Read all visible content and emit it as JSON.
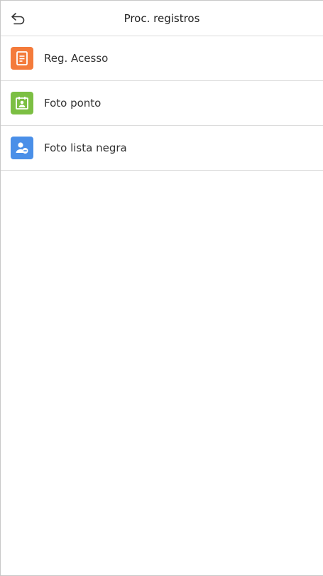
{
  "header": {
    "title": "Proc. registros",
    "back_icon": "undo-arrow-icon"
  },
  "menu": {
    "items": [
      {
        "label": "Reg. Acesso",
        "icon": "document-list-icon",
        "color": "#F47B3B"
      },
      {
        "label": "Foto ponto",
        "icon": "id-photo-icon",
        "color": "#7CBF43"
      },
      {
        "label": "Foto lista negra",
        "icon": "user-remove-icon",
        "color": "#4A8FE8"
      }
    ]
  }
}
